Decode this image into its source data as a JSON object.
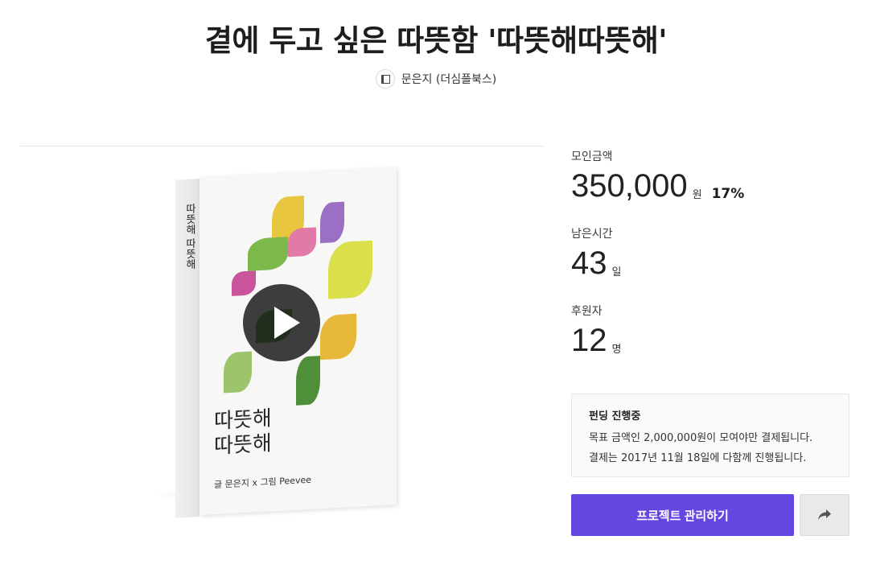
{
  "project": {
    "title": "곁에 두고 싶은 따뜻함 '따뜻해따뜻해'",
    "creator": "문은지 (더심플북스)"
  },
  "media": {
    "cover_title_line1": "따뜻해",
    "cover_title_line2": "따뜻해",
    "cover_credit": "글 문은지 x 그림 Peevee",
    "spine_text": "따뜻해 따뜻해"
  },
  "stats": {
    "funding_label": "모인금액",
    "funding_value": "350,000",
    "funding_unit": "원",
    "funding_percent": "17%",
    "time_label": "남은시간",
    "time_value": "43",
    "time_unit": "일",
    "backers_label": "후원자",
    "backers_value": "12",
    "backers_unit": "명"
  },
  "notice": {
    "title": "펀딩 진행중",
    "line1": "목표 금액인 2,000,000원이 모여야만 결제됩니다.",
    "line2": "결제는 2017년 11월 18일에 다함께 진행됩니다."
  },
  "actions": {
    "manage_label": "프로젝트 관리하기",
    "share_icon": "share-icon"
  },
  "colors": {
    "accent": "#6446e0",
    "share_bg": "#e9e9e9"
  }
}
